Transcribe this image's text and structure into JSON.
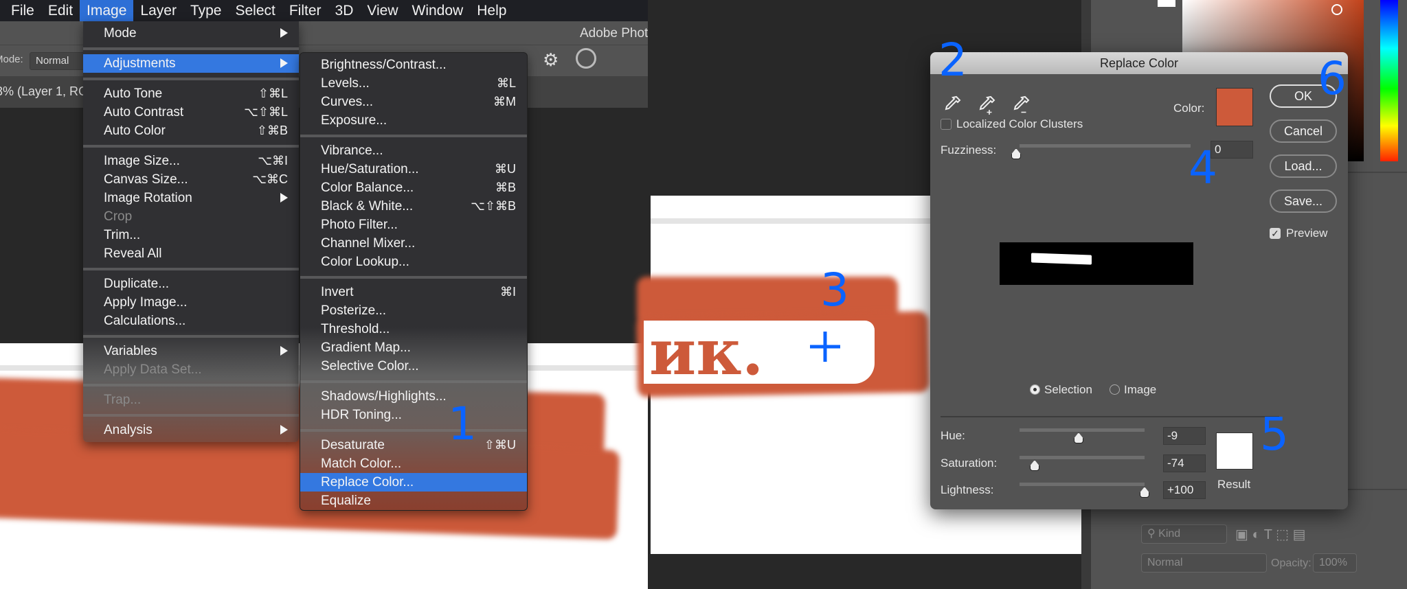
{
  "menubar": {
    "items": [
      "File",
      "Edit",
      "Image",
      "Layer",
      "Type",
      "Select",
      "Filter",
      "3D",
      "View",
      "Window",
      "Help"
    ],
    "active": "Image"
  },
  "app_title": "Adobe Phot",
  "options_bar": {
    "mode_label": "Mode:",
    "mode_value": "Normal"
  },
  "doc_tab": "3% (Layer 1, RGB",
  "image_menu": [
    {
      "label": "Mode",
      "submenu": true
    },
    {
      "sep": true
    },
    {
      "label": "Adjustments",
      "submenu": true,
      "highlight": true
    },
    {
      "sep": true
    },
    {
      "label": "Auto Tone",
      "shortcut": "⇧⌘L"
    },
    {
      "label": "Auto Contrast",
      "shortcut": "⌥⇧⌘L"
    },
    {
      "label": "Auto Color",
      "shortcut": "⇧⌘B"
    },
    {
      "sep": true
    },
    {
      "label": "Image Size...",
      "shortcut": "⌥⌘I"
    },
    {
      "label": "Canvas Size...",
      "shortcut": "⌥⌘C"
    },
    {
      "label": "Image Rotation",
      "submenu": true
    },
    {
      "label": "Crop",
      "disabled": true
    },
    {
      "label": "Trim..."
    },
    {
      "label": "Reveal All"
    },
    {
      "sep": true
    },
    {
      "label": "Duplicate..."
    },
    {
      "label": "Apply Image..."
    },
    {
      "label": "Calculations..."
    },
    {
      "sep": true
    },
    {
      "label": "Variables",
      "submenu": true
    },
    {
      "label": "Apply Data Set...",
      "disabled": true
    },
    {
      "sep": true
    },
    {
      "label": "Trap...",
      "disabled": true
    },
    {
      "sep": true
    },
    {
      "label": "Analysis",
      "submenu": true
    }
  ],
  "adjustments_menu": [
    {
      "label": "Brightness/Contrast..."
    },
    {
      "label": "Levels...",
      "shortcut": "⌘L"
    },
    {
      "label": "Curves...",
      "shortcut": "⌘M"
    },
    {
      "label": "Exposure..."
    },
    {
      "sep": true
    },
    {
      "label": "Vibrance..."
    },
    {
      "label": "Hue/Saturation...",
      "shortcut": "⌘U"
    },
    {
      "label": "Color Balance...",
      "shortcut": "⌘B"
    },
    {
      "label": "Black & White...",
      "shortcut": "⌥⇧⌘B"
    },
    {
      "label": "Photo Filter..."
    },
    {
      "label": "Channel Mixer..."
    },
    {
      "label": "Color Lookup..."
    },
    {
      "sep": true
    },
    {
      "label": "Invert",
      "shortcut": "⌘I"
    },
    {
      "label": "Posterize..."
    },
    {
      "label": "Threshold..."
    },
    {
      "label": "Gradient Map..."
    },
    {
      "label": "Selective Color..."
    },
    {
      "sep": true
    },
    {
      "label": "Shadows/Highlights..."
    },
    {
      "label": "HDR Toning..."
    },
    {
      "sep": true
    },
    {
      "label": "Desaturate",
      "shortcut": "⇧⌘U"
    },
    {
      "label": "Match Color..."
    },
    {
      "label": "Replace Color...",
      "highlight": true
    },
    {
      "label": "Equalize"
    }
  ],
  "canvas_text": "ик.",
  "dialog": {
    "title": "Replace Color",
    "eyedroppers": [
      "eyedropper-icon",
      "eyedropper-plus-icon",
      "eyedropper-minus-icon"
    ],
    "color_label": "Color:",
    "color": "#cd5a3a",
    "localized_label": "Localized Color Clusters",
    "localized_checked": false,
    "fuzziness_label": "Fuzziness:",
    "fuzziness": "0",
    "view_options": [
      "Selection",
      "Image"
    ],
    "view_selected": "Selection",
    "hue_label": "Hue:",
    "hue": "-9",
    "saturation_label": "Saturation:",
    "saturation": "-74",
    "lightness_label": "Lightness:",
    "lightness": "+100",
    "result_label": "Result",
    "result_color": "#ffffff",
    "buttons": {
      "ok": "OK",
      "cancel": "Cancel",
      "load": "Load...",
      "save": "Save..."
    },
    "preview_label": "Preview",
    "preview_checked": true
  },
  "layers_panel": {
    "kind_label": "Kind",
    "blend_mode": "Normal",
    "opacity_label": "Opacity:",
    "opacity": "100%"
  },
  "annotations": [
    "1",
    "2",
    "3",
    "4",
    "5",
    "6"
  ],
  "colors": {
    "accent": "#3478e0",
    "brush": "#cd5a3a",
    "annotation": "#0a63ff"
  }
}
